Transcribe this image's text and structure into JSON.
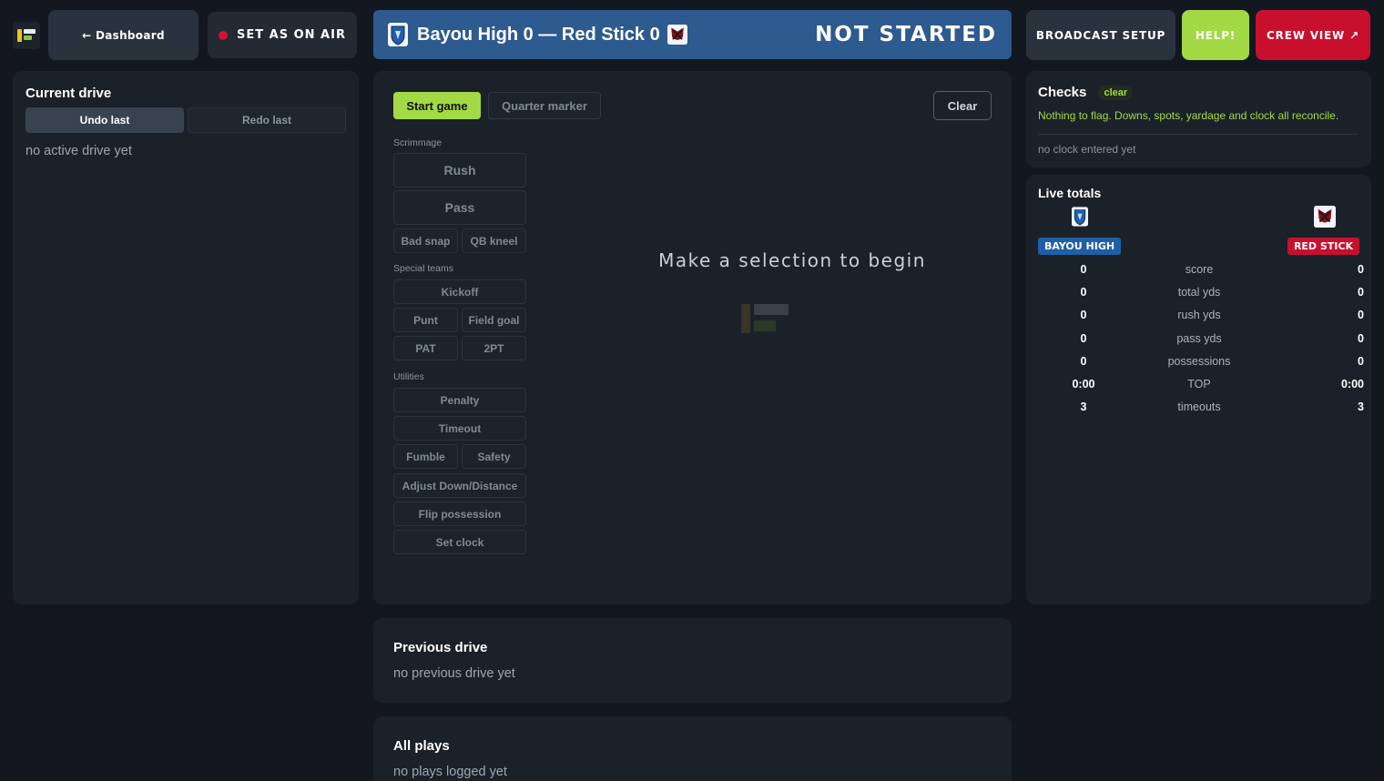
{
  "topbar": {
    "dashboard_label": "← Dashboard",
    "on_air_label": "SET AS ON AIR",
    "scoreline": "Bayou High 0 — Red Stick 0",
    "status": "NOT STARTED",
    "broadcast_label": "BROADCAST SETUP",
    "help_label": "HELP!",
    "crew_label": "CREW VIEW ↗"
  },
  "current_drive": {
    "title": "Current drive",
    "undo_label": "Undo last",
    "redo_label": "Redo last",
    "empty": "no active drive yet"
  },
  "actions": {
    "start_label": "Start game",
    "quarter_label": "Quarter marker",
    "clear_label": "Clear",
    "prompt": "Make a selection to begin",
    "sections": {
      "scrimmage": "Scrimmage",
      "special": "Special teams",
      "utilities": "Utilities"
    },
    "rush": "Rush",
    "pass": "Pass",
    "bad_snap": "Bad snap",
    "qb_kneel": "QB kneel",
    "kickoff": "Kickoff",
    "punt": "Punt",
    "field_goal": "Field goal",
    "pat": "PAT",
    "two_pt": "2PT",
    "penalty": "Penalty",
    "timeout": "Timeout",
    "fumble": "Fumble",
    "safety": "Safety",
    "adjust": "Adjust Down/Distance",
    "flip": "Flip possession",
    "set_clock": "Set clock"
  },
  "checks": {
    "title": "Checks",
    "pill": "clear",
    "message": "Nothing to flag. Downs, spots, yardage and clock all reconcile.",
    "clock_note": "no clock entered yet"
  },
  "live_totals": {
    "title": "Live totals",
    "home_name": "BAYOU HIGH",
    "away_name": "RED STICK",
    "home_color": "#1f5fa8",
    "away_color": "#c8102e",
    "rows": [
      {
        "home": "0",
        "label": "score",
        "away": "0"
      },
      {
        "home": "0",
        "label": "total yds",
        "away": "0"
      },
      {
        "home": "0",
        "label": "rush yds",
        "away": "0"
      },
      {
        "home": "0",
        "label": "pass yds",
        "away": "0"
      },
      {
        "home": "0",
        "label": "possessions",
        "away": "0"
      },
      {
        "home": "0:00",
        "label": "TOP",
        "away": "0:00"
      },
      {
        "home": "3",
        "label": "timeouts",
        "away": "3"
      }
    ]
  },
  "previous_drive": {
    "title": "Previous drive",
    "empty": "no previous drive yet"
  },
  "all_plays": {
    "title": "All plays",
    "empty": "no plays logged yet"
  }
}
